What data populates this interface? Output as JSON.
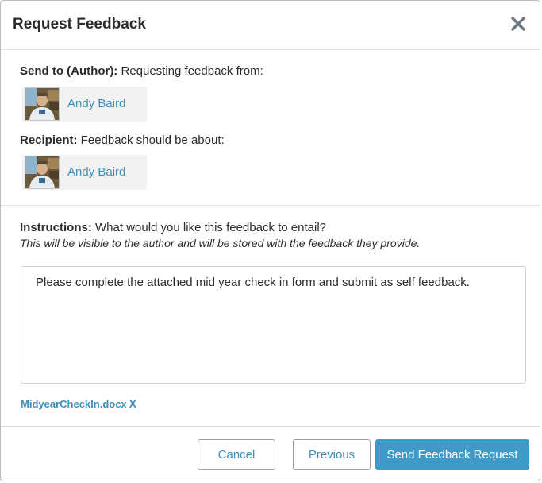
{
  "dialog": {
    "title": "Request Feedback",
    "close_icon": "close-x-icon"
  },
  "send_to": {
    "label_bold": "Send to (Author):",
    "label_text": " Requesting feedback from:",
    "person": {
      "name": "Andy Baird",
      "avatar_icon": "user-photo-avatar"
    }
  },
  "recipient": {
    "label_bold": "Recipient:",
    "label_text": " Feedback should be about:",
    "person": {
      "name": "Andy Baird",
      "avatar_icon": "user-photo-avatar"
    }
  },
  "instructions": {
    "label_bold": "Instructions:",
    "label_text": " What would you like this feedback to entail?",
    "note": "This will be visible to the author and will be stored with the feedback they provide.",
    "value": "Please complete the attached mid year check in form and submit as self feedback."
  },
  "attachment": {
    "filename": "MidyearCheckIn.docx",
    "remove_label": "X"
  },
  "footer": {
    "cancel_label": "Cancel",
    "previous_label": "Previous",
    "send_label": "Send Feedback Request"
  },
  "colors": {
    "accent": "#3d8fb8",
    "primary_button": "#3f9ac7",
    "chip_background": "#f2f2f2",
    "close_icon": "#6f7880"
  }
}
